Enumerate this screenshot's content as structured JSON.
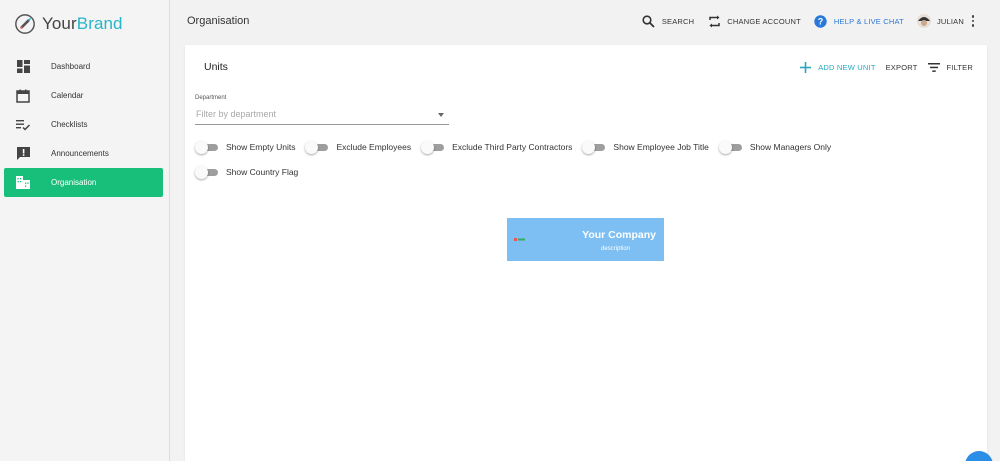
{
  "brand": {
    "part1": "Your",
    "part2": "Brand"
  },
  "sidebar": {
    "items": [
      {
        "label": "Dashboard",
        "icon": "dashboard-icon"
      },
      {
        "label": "Calendar",
        "icon": "calendar-icon"
      },
      {
        "label": "Checklists",
        "icon": "checklist-icon"
      },
      {
        "label": "Announcements",
        "icon": "announcement-icon"
      },
      {
        "label": "Organisation",
        "icon": "building-icon",
        "active": true
      }
    ]
  },
  "header": {
    "title": "Organisation",
    "search_label": "SEARCH",
    "change_account_label": "CHANGE ACCOUNT",
    "help_label": "HELP & LIVE CHAT",
    "user_label": "JULIAN"
  },
  "units": {
    "title": "Units",
    "add_label": "ADD NEW UNIT",
    "export_label": "EXPORT",
    "filter_label": "FILTER",
    "department_label": "Department",
    "department_placeholder": "Filter by department",
    "toggles": [
      "Show Empty Units",
      "Exclude Employees",
      "Exclude Third Party Contractors",
      "Show Employee Job Title",
      "Show Managers Only",
      "Show Country Flag"
    ]
  },
  "org_node": {
    "name": "Your Company",
    "description": "description"
  },
  "colors": {
    "accent": "#18bf7a",
    "brand_teal": "#26b5c9",
    "help_blue": "#2a79d8",
    "node_blue": "#7dbff3"
  }
}
